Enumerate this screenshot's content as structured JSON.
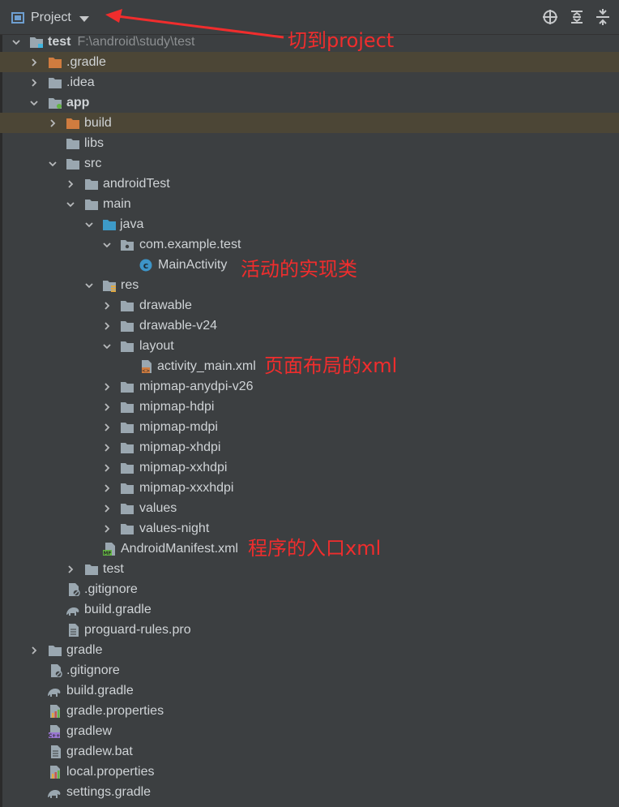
{
  "toolbar": {
    "view_label": "Project",
    "buttons": [
      "locate-icon",
      "expand-all-icon",
      "collapse-all-icon"
    ]
  },
  "annotations": [
    {
      "id": "switch",
      "text": "切到project"
    },
    {
      "id": "activity",
      "text": "活动的实现类"
    },
    {
      "id": "layout",
      "text": "页面布局的xml"
    },
    {
      "id": "manifest",
      "text": "程序的入口xml"
    }
  ],
  "tree": [
    {
      "label": "test",
      "detail": "F:\\android\\study\\test",
      "expanded": true,
      "icon": "module-folder",
      "bold": true
    },
    {
      "label": ".gradle",
      "expanded": false,
      "icon": "excluded-folder"
    },
    {
      "label": ".idea",
      "expanded": false,
      "icon": "folder"
    },
    {
      "label": "app",
      "expanded": true,
      "icon": "module-folder",
      "bold": true
    },
    {
      "label": "build",
      "expanded": false,
      "icon": "excluded-folder"
    },
    {
      "label": "libs",
      "icon": "folder"
    },
    {
      "label": "src",
      "expanded": true,
      "icon": "folder"
    },
    {
      "label": "androidTest",
      "expanded": false,
      "icon": "folder"
    },
    {
      "label": "main",
      "expanded": true,
      "icon": "folder"
    },
    {
      "label": "java",
      "expanded": true,
      "icon": "source-folder"
    },
    {
      "label": "com.example.test",
      "expanded": true,
      "icon": "package"
    },
    {
      "label": "MainActivity",
      "icon": "class"
    },
    {
      "label": "res",
      "expanded": true,
      "icon": "res-folder"
    },
    {
      "label": "drawable",
      "expanded": false,
      "icon": "folder"
    },
    {
      "label": "drawable-v24",
      "expanded": false,
      "icon": "folder"
    },
    {
      "label": "layout",
      "expanded": true,
      "icon": "folder"
    },
    {
      "label": "activity_main.xml",
      "icon": "xml"
    },
    {
      "label": "mipmap-anydpi-v26",
      "expanded": false,
      "icon": "folder"
    },
    {
      "label": "mipmap-hdpi",
      "expanded": false,
      "icon": "folder"
    },
    {
      "label": "mipmap-mdpi",
      "expanded": false,
      "icon": "folder"
    },
    {
      "label": "mipmap-xhdpi",
      "expanded": false,
      "icon": "folder"
    },
    {
      "label": "mipmap-xxhdpi",
      "expanded": false,
      "icon": "folder"
    },
    {
      "label": "mipmap-xxxhdpi",
      "expanded": false,
      "icon": "folder"
    },
    {
      "label": "values",
      "expanded": false,
      "icon": "folder"
    },
    {
      "label": "values-night",
      "expanded": false,
      "icon": "folder"
    },
    {
      "label": "AndroidManifest.xml",
      "icon": "manifest"
    },
    {
      "label": "test",
      "expanded": false,
      "icon": "folder"
    },
    {
      "label": ".gitignore",
      "icon": "gitignore"
    },
    {
      "label": "build.gradle",
      "icon": "gradle"
    },
    {
      "label": "proguard-rules.pro",
      "icon": "text"
    },
    {
      "label": "gradle",
      "expanded": false,
      "icon": "folder"
    },
    {
      "label": ".gitignore",
      "icon": "gitignore"
    },
    {
      "label": "build.gradle",
      "icon": "gradle"
    },
    {
      "label": "gradle.properties",
      "icon": "properties"
    },
    {
      "label": "gradlew",
      "icon": "shell"
    },
    {
      "label": "gradlew.bat",
      "icon": "text"
    },
    {
      "label": "local.properties",
      "icon": "properties"
    },
    {
      "label": "settings.gradle",
      "icon": "gradle"
    }
  ]
}
